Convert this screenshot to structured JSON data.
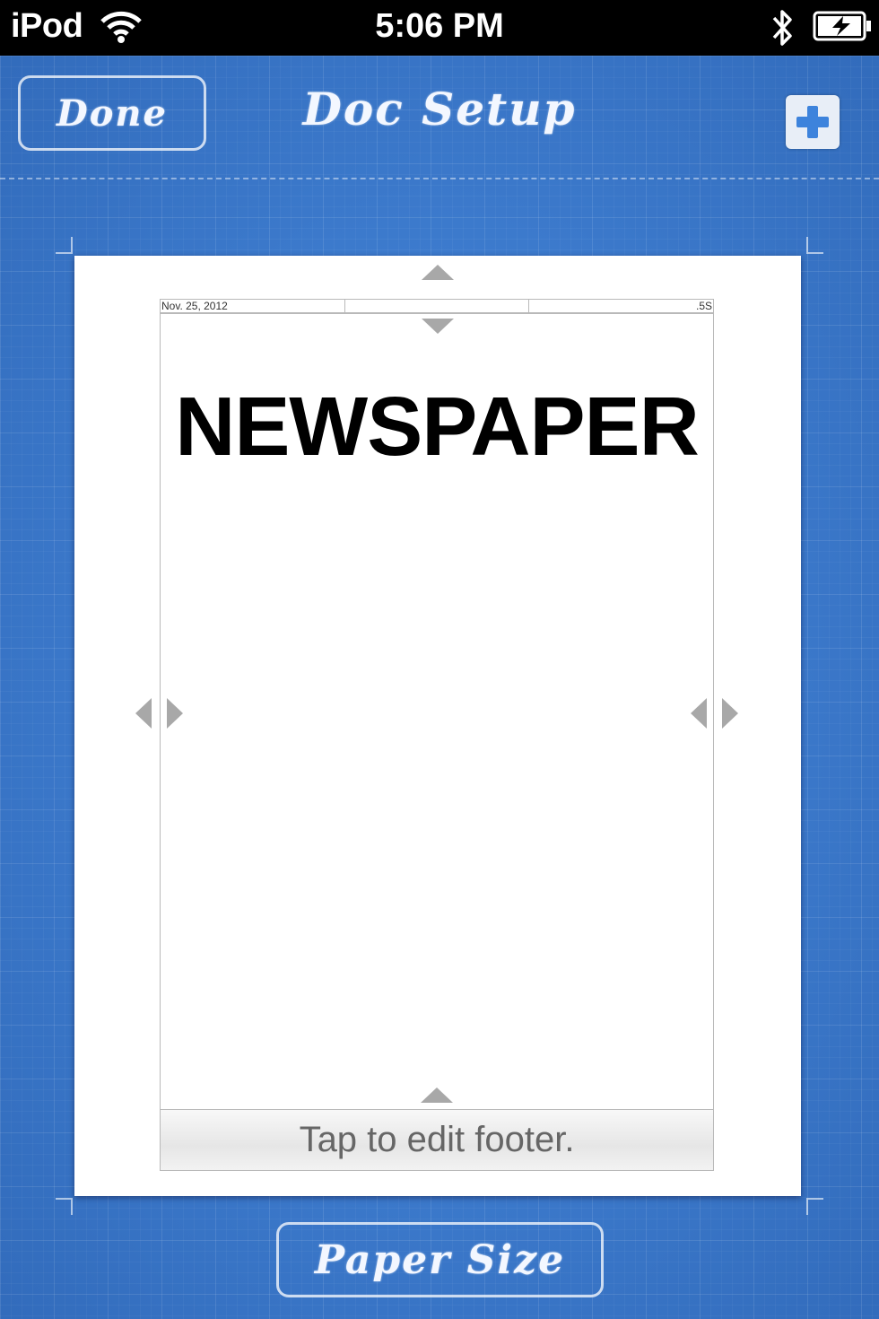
{
  "status_bar": {
    "carrier": "iPod",
    "time": "5:06 PM"
  },
  "nav": {
    "done_label": "Done",
    "title": "Doc Setup"
  },
  "page": {
    "header_cells": [
      "Nov. 25, 2012",
      "",
      "",
      ".5S"
    ],
    "title": "NEWSPAPER",
    "footer_prompt": "Tap to edit footer."
  },
  "bottom": {
    "paper_size_label": "Paper Size"
  },
  "colors": {
    "blueprint_blue": "#3d83dc",
    "handle_gray": "#a8a8a8"
  }
}
